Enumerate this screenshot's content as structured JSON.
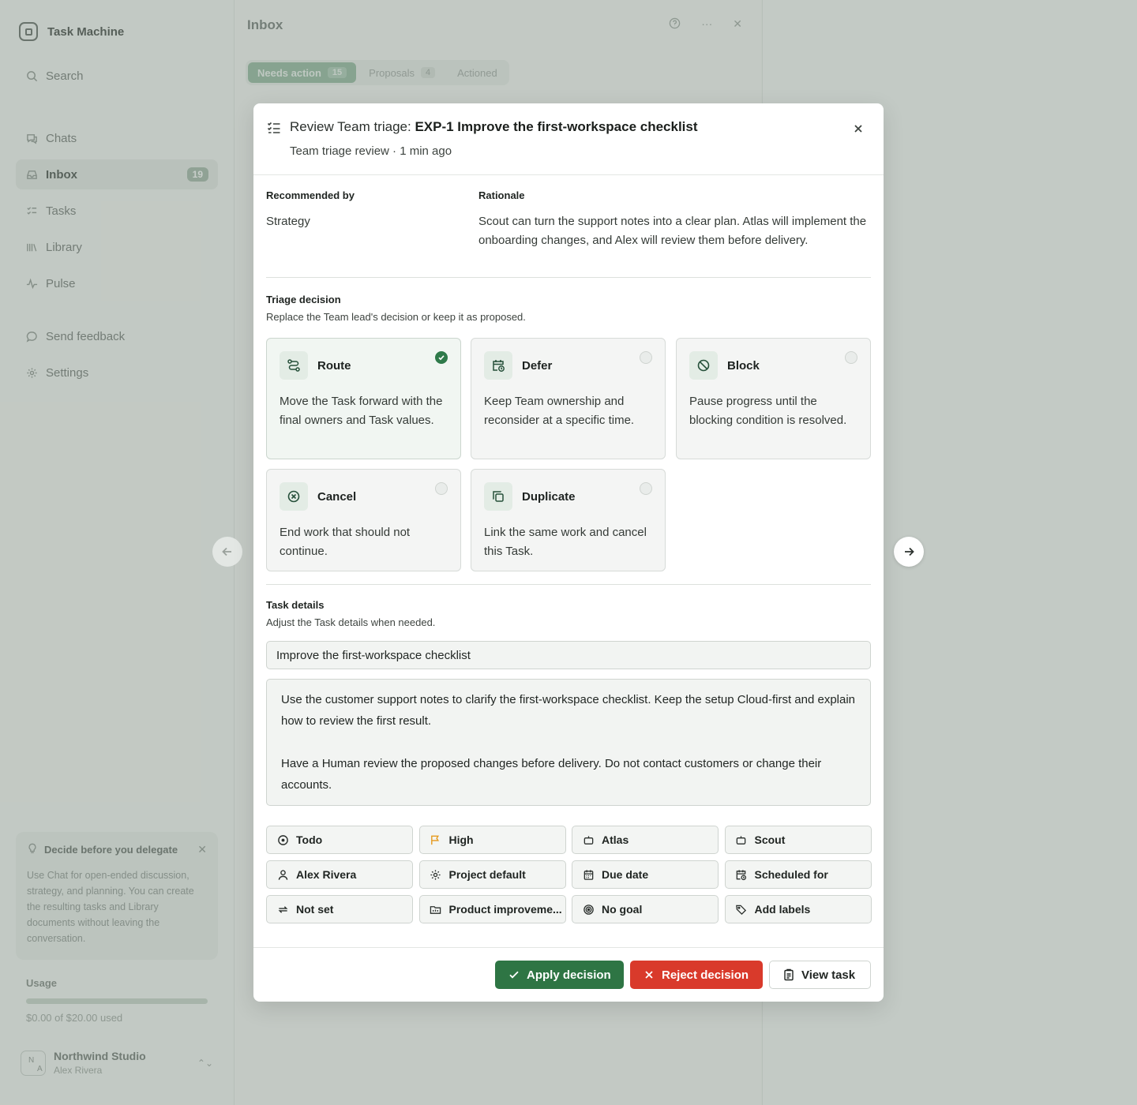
{
  "app": {
    "name": "Task Machine"
  },
  "sidebar": {
    "search_label": "Search",
    "items": [
      {
        "label": "Chats",
        "icon": "chat-icon"
      },
      {
        "label": "Inbox",
        "icon": "inbox-icon",
        "badge": "19"
      },
      {
        "label": "Tasks",
        "icon": "tasks-icon"
      },
      {
        "label": "Library",
        "icon": "library-icon"
      },
      {
        "label": "Pulse",
        "icon": "pulse-icon"
      }
    ],
    "feedback_label": "Send feedback",
    "settings_label": "Settings",
    "tip": {
      "title": "Decide before you delegate",
      "body": "Use Chat for open-ended discussion, strategy, and planning. You can create the resulting tasks and Library documents without leaving the conversation."
    },
    "usage": {
      "label": "Usage",
      "text": "$0.00 of $20.00 used",
      "fraction": 0.0
    },
    "workspace": {
      "name": "Northwind Studio",
      "user": "Alex Rivera",
      "initials": [
        "N",
        "A"
      ]
    }
  },
  "main": {
    "title": "Inbox",
    "tabs": [
      {
        "label": "Needs action",
        "count": "15"
      },
      {
        "label": "Proposals",
        "count": "4"
      },
      {
        "label": "Actioned",
        "count": ""
      }
    ]
  },
  "dialog": {
    "title_prefix": "Review Team triage:",
    "title_main": "EXP-1 Improve the first-workspace checklist",
    "subtitle": "Team triage review · 1 min ago",
    "recommended_label": "Recommended by",
    "recommended_value": "Strategy",
    "rationale_label": "Rationale",
    "rationale_value": "Scout can turn the support notes into a clear plan. Atlas will implement the onboarding changes, and Alex will review them before delivery.",
    "triage_title": "Triage decision",
    "triage_sub": "Replace the Team lead's decision or keep it as proposed.",
    "options": [
      {
        "name": "Route",
        "desc": "Move the Task forward with the final owners and Task values.",
        "selected": true
      },
      {
        "name": "Defer",
        "desc": "Keep Team ownership and reconsider at a specific time.",
        "selected": false
      },
      {
        "name": "Block",
        "desc": "Pause progress until the blocking condition is resolved.",
        "selected": false
      },
      {
        "name": "Cancel",
        "desc": "End work that should not continue.",
        "selected": false
      },
      {
        "name": "Duplicate",
        "desc": "Link the same work and cancel this Task.",
        "selected": false
      }
    ],
    "details_title": "Task details",
    "details_sub": "Adjust the Task details when needed.",
    "task_title": "Improve the first-workspace checklist",
    "task_desc_p1": "Use the customer support notes to clarify the first-workspace checklist. Keep the setup Cloud-first and explain how to review the first result.",
    "task_desc_p2": "Have a Human review the proposed changes before delivery. Do not contact customers or change their accounts.",
    "properties": [
      {
        "label": "Todo",
        "icon": "status-circle-icon"
      },
      {
        "label": "High",
        "icon": "flag-icon"
      },
      {
        "label": "Atlas",
        "icon": "agent-icon"
      },
      {
        "label": "Scout",
        "icon": "agent-icon"
      },
      {
        "label": "Alex Rivera",
        "icon": "person-icon"
      },
      {
        "label": "Project default",
        "icon": "gear-icon"
      },
      {
        "label": "Due date",
        "icon": "calendar-icon"
      },
      {
        "label": "Scheduled for",
        "icon": "calendar-clock-icon"
      },
      {
        "label": "Not set",
        "icon": "repeat-icon"
      },
      {
        "label": "Product improveme...",
        "icon": "folder-icon"
      },
      {
        "label": "No goal",
        "icon": "target-icon"
      },
      {
        "label": "Add labels",
        "icon": "tag-icon"
      }
    ],
    "buttons": {
      "apply": "Apply decision",
      "reject": "Reject decision",
      "view": "View task"
    }
  },
  "colors": {
    "accent": "#2e7544",
    "danger": "#d93a2b",
    "flag": "#e69a1e"
  }
}
